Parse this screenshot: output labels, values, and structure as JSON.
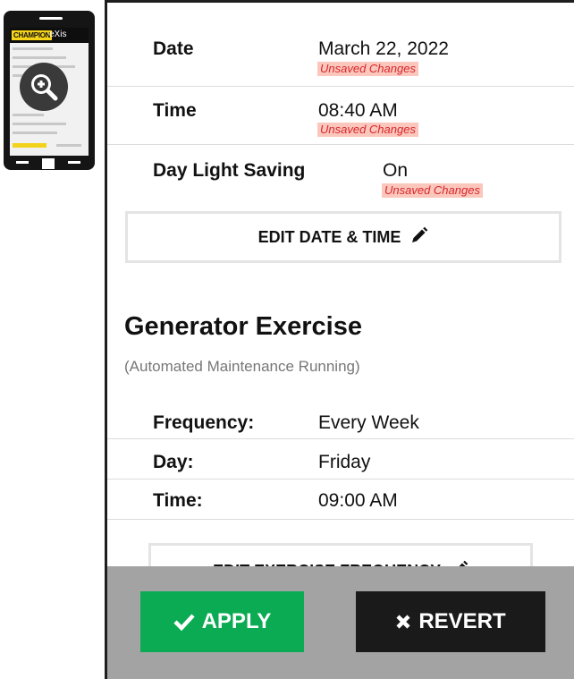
{
  "thumbnail": {
    "brand_primary": "CHAMPION",
    "brand_secondary": "eXis"
  },
  "datetime": {
    "date_label": "Date",
    "date_value": "March 22, 2022",
    "time_label": "Time",
    "time_value": "08:40 AM",
    "dst_label": "Day Light Saving",
    "dst_value": "On",
    "unsaved_text": "Unsaved Changes",
    "edit_button_label": "EDIT DATE & TIME"
  },
  "exercise": {
    "title": "Generator Exercise",
    "subtitle": "(Automated Maintenance Running)",
    "frequency_label": "Frequency:",
    "frequency_value": "Every Week",
    "day_label": "Day:",
    "day_value": "Friday",
    "time_label": "Time:",
    "time_value": "09:00 AM",
    "edit_button_label": "EDIT EXERCISE FREQUENCY"
  },
  "actions": {
    "apply_label": "APPLY",
    "revert_label": "REVERT"
  },
  "colors": {
    "apply": "#0bab53",
    "revert": "#1a1a1a",
    "unsaved_bg": "#fbc7bd",
    "unsaved_text": "#d8262b",
    "footer": "#a3a3a3"
  },
  "icons": [
    "zoom-in-icon",
    "pencil-icon",
    "check-icon",
    "x-icon"
  ]
}
